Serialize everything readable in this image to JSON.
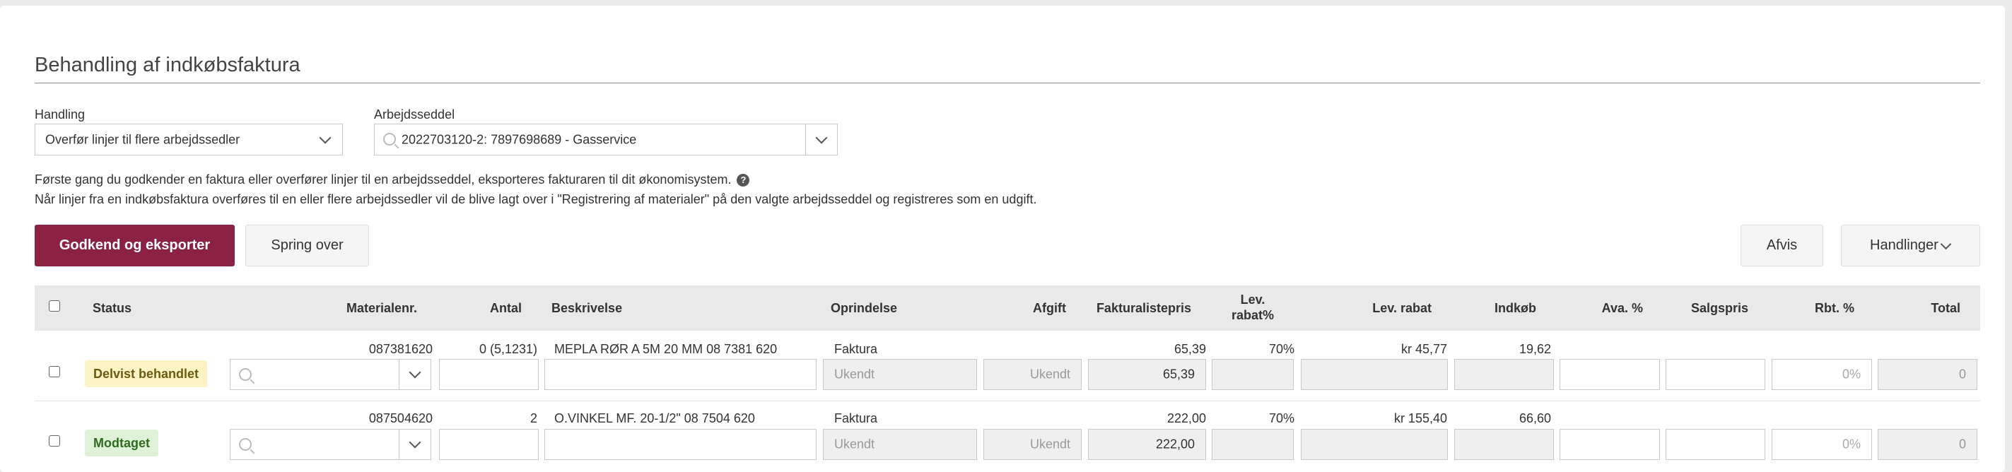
{
  "page": {
    "title": "Behandling af indkøbsfaktura"
  },
  "form": {
    "handling_label": "Handling",
    "handling_value": "Overfør linjer til flere arbejdssedler",
    "arbejdsseddel_label": "Arbejdsseddel",
    "arbejdsseddel_value": "2022703120-2:  7897698689 - Gasservice"
  },
  "info": {
    "line1": "Første gang du godkender en faktura eller overfører linjer til en arbejdsseddel, eksporteres fakturaren til dit økonomisystem.",
    "line2": "Når linjer fra en indkøbsfaktura overføres til en eller flere arbejdssedler vil de blive lagt over i \"Registrering af materialer\" på den valgte arbejdsseddel og registreres som en udgift."
  },
  "buttons": {
    "approve": "Godkend og eksporter",
    "skip": "Spring over",
    "reject": "Afvis",
    "actions": "Handlinger"
  },
  "table": {
    "headers": {
      "status": "Status",
      "materialenr": "Materialenr.",
      "antal": "Antal",
      "beskrivelse": "Beskrivelse",
      "oprindelse": "Oprindelse",
      "afgift": "Afgift",
      "fakturalistepris": "Fakturalistepris",
      "lev_rabat_pct_1": "Lev.",
      "lev_rabat_pct_2": "rabat%",
      "lev_rabat": "Lev. rabat",
      "indkob": "Indkøb",
      "ava": "Ava. %",
      "salgspris": "Salgspris",
      "rbt": "Rbt. %",
      "total": "Total"
    },
    "rows": [
      {
        "status": "Delvist behandlet",
        "status_color": "#fbf3c4",
        "materialenr": "087381620",
        "antal": "0 (5,1231)",
        "beskrivelse": "MEPLA RØR A 5M 20 MM 08 7381 620",
        "oprindelse": "Faktura",
        "fakturalistepris": "65,39",
        "lev_rabat_pct": "70%",
        "lev_rabat": "kr 45,77",
        "indkob": "19,62",
        "oprindelse_input": "Ukendt",
        "afgift_input": "Ukendt",
        "fakturalistepris_input": "65,39",
        "rbt_input": "0%",
        "total_input": "0"
      },
      {
        "status": "Modtaget",
        "status_color": "#dff2d8",
        "materialenr": "087504620",
        "antal": "2",
        "beskrivelse": "O.VINKEL MF. 20-1/2\" 08 7504 620",
        "oprindelse": "Faktura",
        "fakturalistepris": "222,00",
        "lev_rabat_pct": "70%",
        "lev_rabat": "kr 155,40",
        "indkob": "66,60",
        "oprindelse_input": "Ukendt",
        "afgift_input": "Ukendt",
        "fakturalistepris_input": "222,00",
        "rbt_input": "0%",
        "total_input": "0"
      }
    ]
  }
}
